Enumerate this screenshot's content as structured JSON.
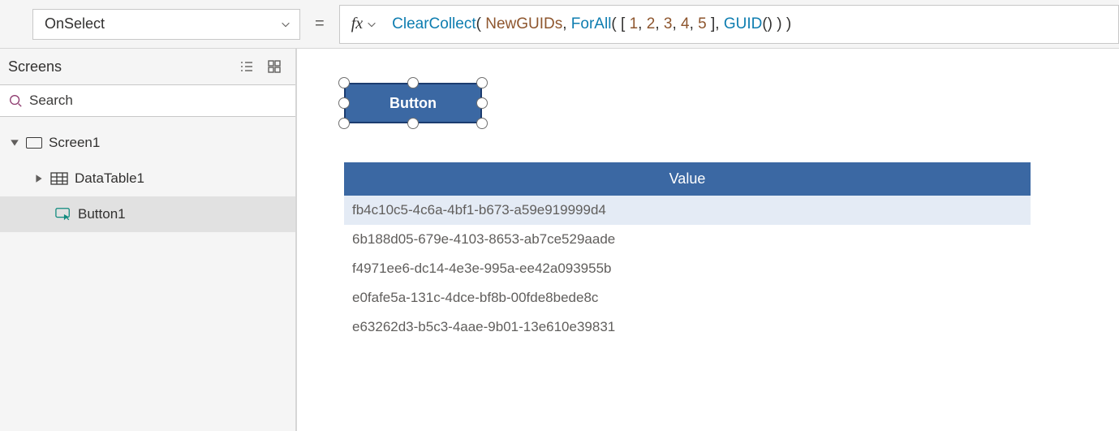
{
  "topbar": {
    "property": "OnSelect",
    "equals": "=",
    "fx": "fx",
    "formula_tokens": [
      {
        "t": "fn",
        "v": "ClearCollect"
      },
      {
        "t": "punc",
        "v": "( "
      },
      {
        "t": "ident",
        "v": "NewGUIDs"
      },
      {
        "t": "punc",
        "v": ", "
      },
      {
        "t": "fn",
        "v": "ForAll"
      },
      {
        "t": "punc",
        "v": "( [ "
      },
      {
        "t": "num",
        "v": "1"
      },
      {
        "t": "punc",
        "v": ", "
      },
      {
        "t": "num",
        "v": "2"
      },
      {
        "t": "punc",
        "v": ", "
      },
      {
        "t": "num",
        "v": "3"
      },
      {
        "t": "punc",
        "v": ", "
      },
      {
        "t": "num",
        "v": "4"
      },
      {
        "t": "punc",
        "v": ", "
      },
      {
        "t": "num",
        "v": "5"
      },
      {
        "t": "punc",
        "v": " ], "
      },
      {
        "t": "fn",
        "v": "GUID"
      },
      {
        "t": "punc",
        "v": "() ) )"
      }
    ]
  },
  "tree": {
    "title": "Screens",
    "search_placeholder": "Search",
    "nodes": {
      "screen1": "Screen1",
      "datatable1": "DataTable1",
      "button1": "Button1"
    }
  },
  "canvas": {
    "button_text": "Button"
  },
  "dataTable": {
    "header": "Value",
    "rows": [
      "fb4c10c5-4c6a-4bf1-b673-a59e919999d4",
      "6b188d05-679e-4103-8653-ab7ce529aade",
      "f4971ee6-dc14-4e3e-995a-ee42a093955b",
      "e0fafe5a-131c-4dce-bf8b-00fde8bede8c",
      "e63262d3-b5c3-4aae-9b01-13e610e39831"
    ]
  }
}
